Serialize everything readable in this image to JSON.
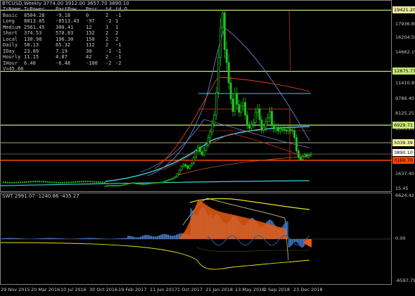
{
  "header": {
    "symbol_line": "BTCUSD,Weekly  3774.00 3912.00 3657.70 3890.10"
  },
  "info_table": {
    "columns": [
      "TrName",
      "TrPower",
      "PartPow",
      "Perc",
      "td",
      "td_O"
    ],
    "rows": [
      [
        "Basic",
        "8504.28",
        "-9.18",
        "0",
        "2",
        "-1"
      ],
      [
        "Long",
        "8813.85",
        "-8513.43",
        "-97",
        "-2",
        "1"
      ],
      [
        "Medium",
        "2561.45",
        "300.41",
        "12",
        "1",
        "1"
      ],
      [
        "Short",
        "374.53",
        "570.83",
        "152",
        "2",
        "2"
      ],
      [
        "Local",
        "130.98",
        "196.30",
        "150",
        "2",
        "2"
      ],
      [
        "Daily",
        "58.13",
        "65.32",
        "112",
        "2",
        "-1"
      ],
      [
        "IDay",
        "23.89",
        "7.19",
        "30",
        "-1",
        "-1"
      ],
      [
        "Hourly",
        "11.15",
        "4.87",
        "42",
        "2",
        "-1"
      ],
      [
        "IHour",
        "6.48",
        "-6.48",
        "-100",
        "-2",
        "-2"
      ]
    ],
    "footer": "V=45.60"
  },
  "price_axis": {
    "ticks": [
      "17936.85",
      "16204.55",
      "14662.15",
      "11410.85",
      "9786.40",
      "8125.25",
      "6503.25",
      "1637.40",
      "15.45"
    ]
  },
  "price_tags": [
    {
      "value": "19421.20",
      "bg": "#e8e8a0",
      "fg": "#000000"
    },
    {
      "value": "12875.77",
      "bg": "#c8e873",
      "fg": "#000000"
    },
    {
      "value": "6929.71",
      "bg": "#c8e873",
      "fg": "#000000"
    },
    {
      "value": "5039.39",
      "bg": "#f4f4a0",
      "fg": "#000000"
    },
    {
      "value": "3890.10",
      "bg": "#ffffff",
      "fg": "#000000"
    },
    {
      "value": "3169.70",
      "bg": "#ff4500",
      "fg": "#000000"
    }
  ],
  "indicator": {
    "label": "SWT 2991.07 -1240.86 -435.27",
    "ticks": [
      "6624.42",
      "0.00",
      "-6597.79"
    ]
  },
  "time_axis": {
    "labels": [
      "29 Nov 2015",
      "20 Mar 2016",
      "10 Jul 2016",
      "30 Oct 2016",
      "19 Feb 2017",
      "11 Jun 2017",
      "1 Oct 2017",
      "21 Jan 2018",
      "13 May 2018",
      "2 Sep 2018",
      "23 Dec 2018"
    ]
  },
  "chart_data": {
    "type": "candlestick",
    "title": "BTCUSD,Weekly",
    "ohlc_last": {
      "open": 3774.0,
      "high": 3912.0,
      "low": 3657.7,
      "close": 3890.1
    },
    "ylim": [
      15.45,
      19600
    ],
    "x_labels": [
      "29 Nov 2015",
      "20 Mar 2016",
      "10 Jul 2016",
      "30 Oct 2016",
      "19 Feb 2017",
      "11 Jun 2017",
      "1 Oct 2017",
      "21 Jan 2018",
      "13 May 2018",
      "2 Sep 2018",
      "23 Dec 2018"
    ],
    "approx_close_series": [
      380,
      420,
      430,
      440,
      420,
      410,
      430,
      450,
      470,
      520,
      580,
      650,
      680,
      720,
      660,
      640,
      620,
      610,
      600,
      600,
      620,
      640,
      680,
      700,
      720,
      740,
      760,
      780,
      820,
      900,
      990,
      1050,
      1150,
      1250,
      1400,
      1700,
      2100,
      2500,
      2700,
      2550,
      2300,
      2600,
      2850,
      3500,
      4200,
      4600,
      4100,
      3800,
      4300,
      4800,
      5600,
      6200,
      7100,
      8000,
      10500,
      14200,
      17600,
      19100,
      15000,
      13700,
      11500,
      9800,
      8400,
      10400,
      9200,
      8300,
      9000,
      9400,
      8000,
      6900,
      6600,
      7000,
      7200,
      8300,
      8700,
      7500,
      6400,
      6700,
      7300,
      7700,
      8400,
      7000,
      6500,
      6700,
      6300,
      6500,
      6500,
      6400,
      6300,
      6500,
      6400,
      6300,
      5600,
      4200,
      3500,
      3250,
      3600,
      3800,
      3650,
      3750,
      3890
    ],
    "levels": [
      19421.2,
      12875.77,
      6929.71,
      5039.39,
      3890.1,
      3169.7
    ],
    "indicator": {
      "name": "SWT",
      "values": [
        2991.07,
        -1240.86,
        -435.27
      ],
      "ylim": [
        -6597.79,
        6624.42
      ]
    }
  }
}
